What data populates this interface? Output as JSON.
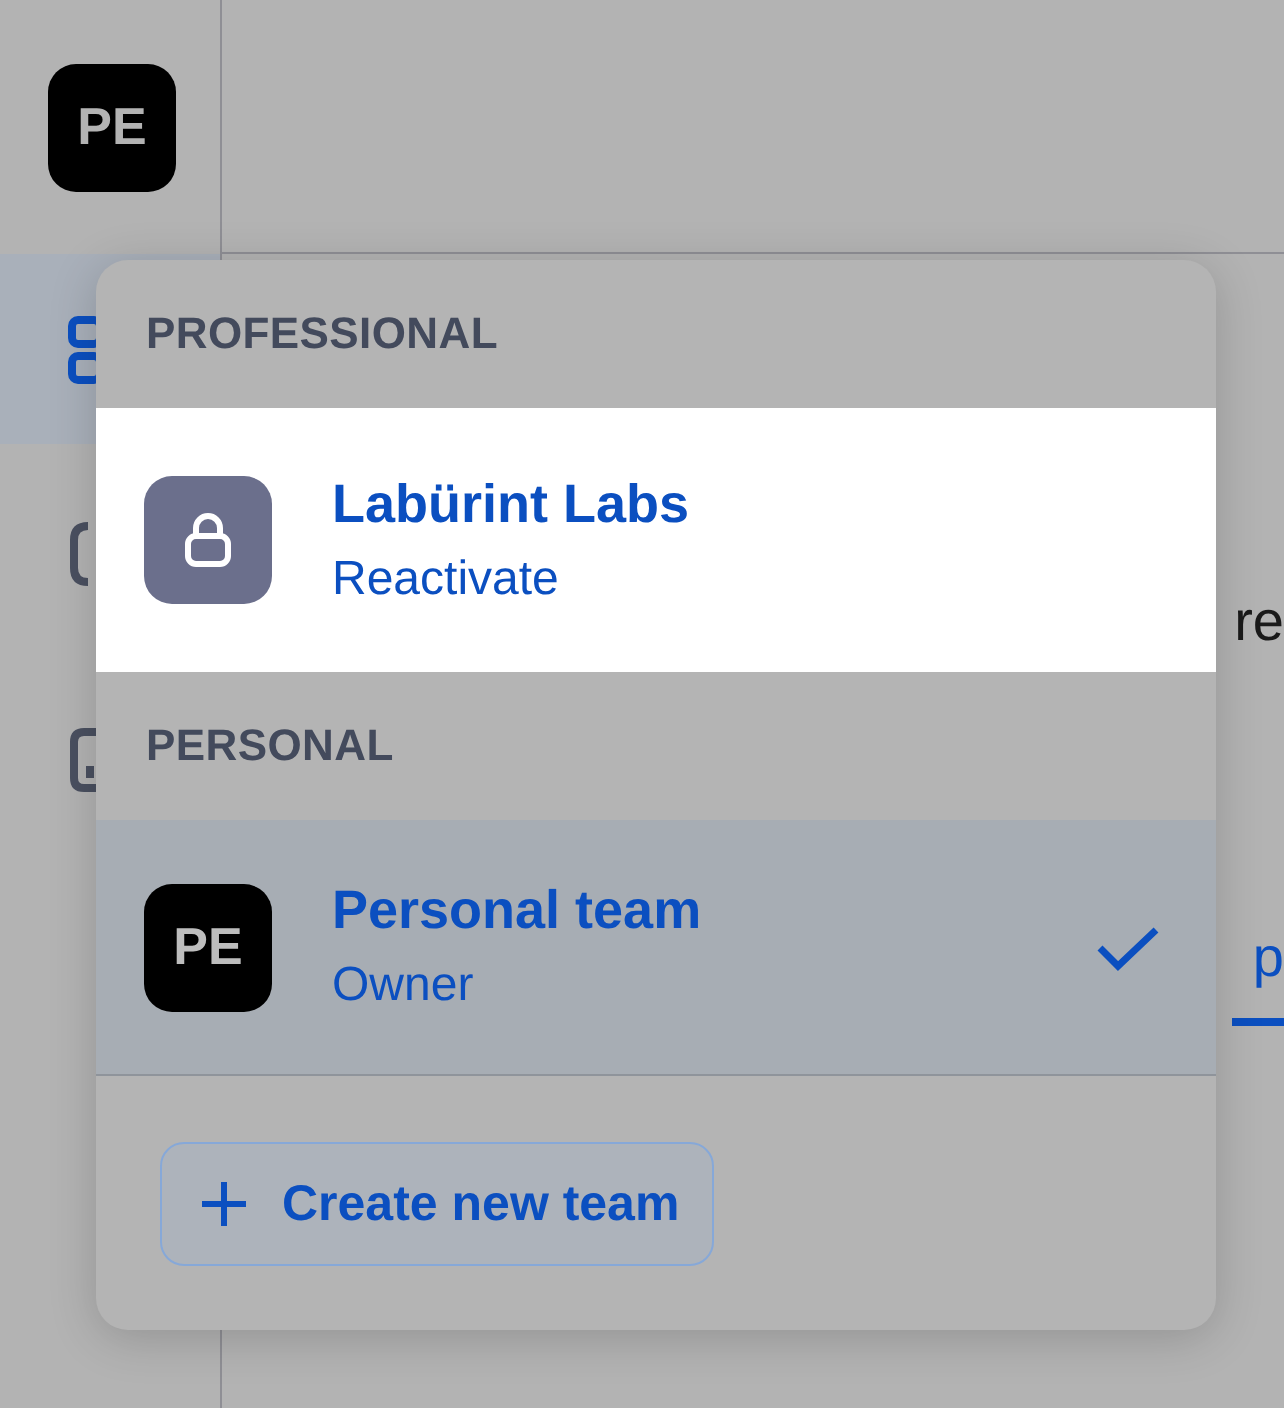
{
  "sidebar": {
    "avatar": "PE",
    "nav_items": [
      {
        "selected": true
      },
      {
        "selected": false
      },
      {
        "selected": false
      }
    ]
  },
  "background_texts": [
    "re",
    "p"
  ],
  "team_menu": {
    "sections": [
      {
        "heading": "PROFESSIONAL",
        "teams": [
          {
            "kind": "locked",
            "name": "Labürint Labs",
            "subtitle": "Reactivate",
            "highlighted": true,
            "selected": false
          }
        ]
      },
      {
        "heading": "PERSONAL",
        "teams": [
          {
            "kind": "avatar",
            "avatar": "PE",
            "name": "Personal team",
            "subtitle": "Owner",
            "highlighted": false,
            "selected": true
          }
        ]
      }
    ],
    "create_button": {
      "label": "Create new team"
    }
  }
}
